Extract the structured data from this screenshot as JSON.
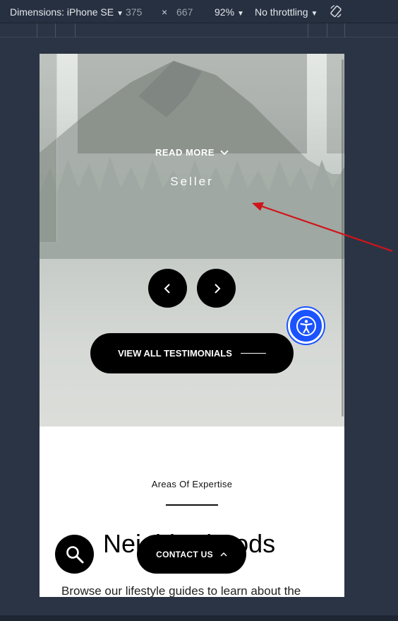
{
  "devtools": {
    "dimensions_label": "Dimensions: iPhone SE",
    "width": "375",
    "times": "×",
    "height": "667",
    "zoom": "92%",
    "throttling": "No throttling"
  },
  "hero": {
    "read_more": "READ MORE",
    "role": "Seller",
    "view_all": "VIEW ALL TESTIMONIALS"
  },
  "section": {
    "eyebrow": "Areas Of Expertise",
    "heading": "Neighborhoods",
    "body": "Browse our lifestyle guides to learn about the"
  },
  "floating": {
    "contact": "CONTACT US"
  },
  "colors": {
    "accent_blue": "#1a53ff",
    "annotation_red": "#d0141a",
    "button_black": "#000000"
  }
}
